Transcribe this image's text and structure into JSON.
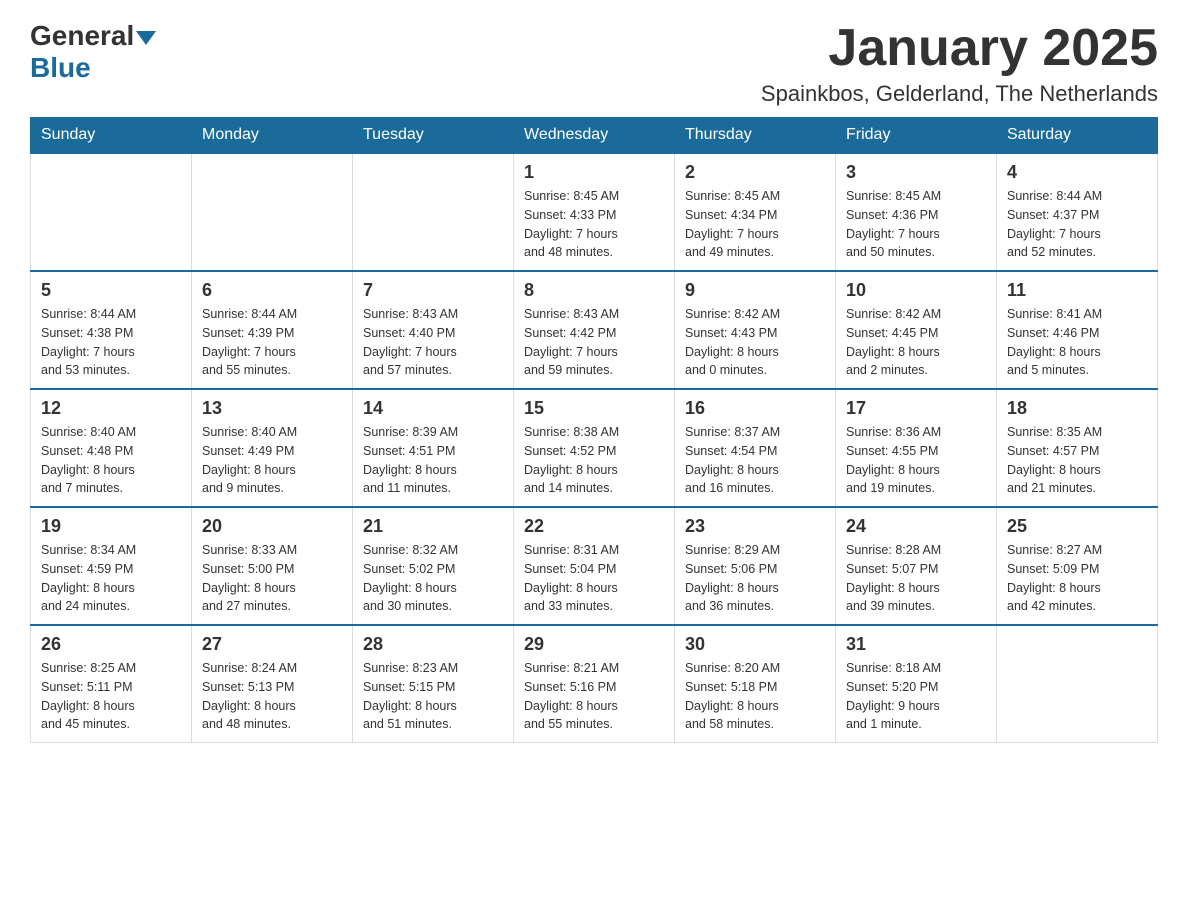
{
  "logo": {
    "general": "General",
    "blue": "Blue"
  },
  "title": "January 2025",
  "subtitle": "Spainkbos, Gelderland, The Netherlands",
  "days_of_week": [
    "Sunday",
    "Monday",
    "Tuesday",
    "Wednesday",
    "Thursday",
    "Friday",
    "Saturday"
  ],
  "weeks": [
    [
      {
        "day": "",
        "info": ""
      },
      {
        "day": "",
        "info": ""
      },
      {
        "day": "",
        "info": ""
      },
      {
        "day": "1",
        "info": "Sunrise: 8:45 AM\nSunset: 4:33 PM\nDaylight: 7 hours\nand 48 minutes."
      },
      {
        "day": "2",
        "info": "Sunrise: 8:45 AM\nSunset: 4:34 PM\nDaylight: 7 hours\nand 49 minutes."
      },
      {
        "day": "3",
        "info": "Sunrise: 8:45 AM\nSunset: 4:36 PM\nDaylight: 7 hours\nand 50 minutes."
      },
      {
        "day": "4",
        "info": "Sunrise: 8:44 AM\nSunset: 4:37 PM\nDaylight: 7 hours\nand 52 minutes."
      }
    ],
    [
      {
        "day": "5",
        "info": "Sunrise: 8:44 AM\nSunset: 4:38 PM\nDaylight: 7 hours\nand 53 minutes."
      },
      {
        "day": "6",
        "info": "Sunrise: 8:44 AM\nSunset: 4:39 PM\nDaylight: 7 hours\nand 55 minutes."
      },
      {
        "day": "7",
        "info": "Sunrise: 8:43 AM\nSunset: 4:40 PM\nDaylight: 7 hours\nand 57 minutes."
      },
      {
        "day": "8",
        "info": "Sunrise: 8:43 AM\nSunset: 4:42 PM\nDaylight: 7 hours\nand 59 minutes."
      },
      {
        "day": "9",
        "info": "Sunrise: 8:42 AM\nSunset: 4:43 PM\nDaylight: 8 hours\nand 0 minutes."
      },
      {
        "day": "10",
        "info": "Sunrise: 8:42 AM\nSunset: 4:45 PM\nDaylight: 8 hours\nand 2 minutes."
      },
      {
        "day": "11",
        "info": "Sunrise: 8:41 AM\nSunset: 4:46 PM\nDaylight: 8 hours\nand 5 minutes."
      }
    ],
    [
      {
        "day": "12",
        "info": "Sunrise: 8:40 AM\nSunset: 4:48 PM\nDaylight: 8 hours\nand 7 minutes."
      },
      {
        "day": "13",
        "info": "Sunrise: 8:40 AM\nSunset: 4:49 PM\nDaylight: 8 hours\nand 9 minutes."
      },
      {
        "day": "14",
        "info": "Sunrise: 8:39 AM\nSunset: 4:51 PM\nDaylight: 8 hours\nand 11 minutes."
      },
      {
        "day": "15",
        "info": "Sunrise: 8:38 AM\nSunset: 4:52 PM\nDaylight: 8 hours\nand 14 minutes."
      },
      {
        "day": "16",
        "info": "Sunrise: 8:37 AM\nSunset: 4:54 PM\nDaylight: 8 hours\nand 16 minutes."
      },
      {
        "day": "17",
        "info": "Sunrise: 8:36 AM\nSunset: 4:55 PM\nDaylight: 8 hours\nand 19 minutes."
      },
      {
        "day": "18",
        "info": "Sunrise: 8:35 AM\nSunset: 4:57 PM\nDaylight: 8 hours\nand 21 minutes."
      }
    ],
    [
      {
        "day": "19",
        "info": "Sunrise: 8:34 AM\nSunset: 4:59 PM\nDaylight: 8 hours\nand 24 minutes."
      },
      {
        "day": "20",
        "info": "Sunrise: 8:33 AM\nSunset: 5:00 PM\nDaylight: 8 hours\nand 27 minutes."
      },
      {
        "day": "21",
        "info": "Sunrise: 8:32 AM\nSunset: 5:02 PM\nDaylight: 8 hours\nand 30 minutes."
      },
      {
        "day": "22",
        "info": "Sunrise: 8:31 AM\nSunset: 5:04 PM\nDaylight: 8 hours\nand 33 minutes."
      },
      {
        "day": "23",
        "info": "Sunrise: 8:29 AM\nSunset: 5:06 PM\nDaylight: 8 hours\nand 36 minutes."
      },
      {
        "day": "24",
        "info": "Sunrise: 8:28 AM\nSunset: 5:07 PM\nDaylight: 8 hours\nand 39 minutes."
      },
      {
        "day": "25",
        "info": "Sunrise: 8:27 AM\nSunset: 5:09 PM\nDaylight: 8 hours\nand 42 minutes."
      }
    ],
    [
      {
        "day": "26",
        "info": "Sunrise: 8:25 AM\nSunset: 5:11 PM\nDaylight: 8 hours\nand 45 minutes."
      },
      {
        "day": "27",
        "info": "Sunrise: 8:24 AM\nSunset: 5:13 PM\nDaylight: 8 hours\nand 48 minutes."
      },
      {
        "day": "28",
        "info": "Sunrise: 8:23 AM\nSunset: 5:15 PM\nDaylight: 8 hours\nand 51 minutes."
      },
      {
        "day": "29",
        "info": "Sunrise: 8:21 AM\nSunset: 5:16 PM\nDaylight: 8 hours\nand 55 minutes."
      },
      {
        "day": "30",
        "info": "Sunrise: 8:20 AM\nSunset: 5:18 PM\nDaylight: 8 hours\nand 58 minutes."
      },
      {
        "day": "31",
        "info": "Sunrise: 8:18 AM\nSunset: 5:20 PM\nDaylight: 9 hours\nand 1 minute."
      },
      {
        "day": "",
        "info": ""
      }
    ]
  ]
}
